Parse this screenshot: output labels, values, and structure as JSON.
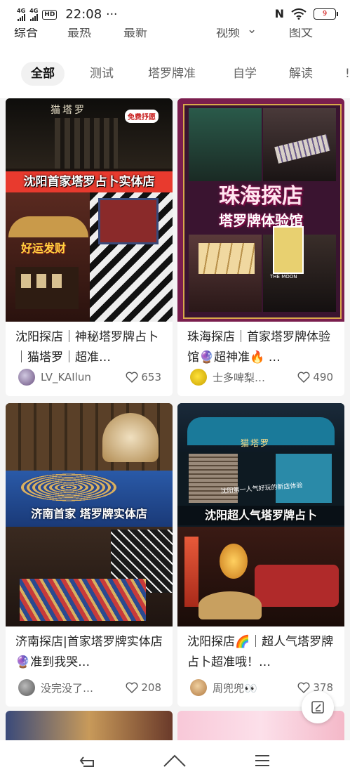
{
  "status_bar": {
    "network1": "4G",
    "network2": "4G",
    "hd": "HD",
    "time": "22:08",
    "more": "···",
    "nfc": "N",
    "battery": "9"
  },
  "top_tabs": [
    "综合",
    "最热",
    "最新",
    "视频",
    "图文"
  ],
  "filters": [
    "全部",
    "测试",
    "塔罗牌准",
    "自学",
    "解读"
  ],
  "cards": [
    {
      "title": "沈阳探店｜神秘塔罗牌占卜｜猫塔罗｜超准…",
      "author": "LV_KAIlun",
      "likes": "653",
      "banner": "沈阳首家塔罗占卜实体店",
      "sign": "猫塔罗",
      "sticker": "免费抒愿",
      "badge": "好运发财"
    },
    {
      "title": "珠海探店｜首家塔罗牌体验馆🔮超神准🔥 …",
      "author": "士多啤梨…",
      "likes": "490",
      "banner1": "珠海探店",
      "banner2": "塔罗牌体验馆",
      "card_label": "THE MOON"
    },
    {
      "title": "济南探店|首家塔罗牌实体店🔮准到我哭…",
      "author": "没完没了…",
      "likes": "208",
      "banner": "济南首家 塔罗牌实体店"
    },
    {
      "title": "沈阳探店🌈｜超人气塔罗牌占卜超准哦！…",
      "author": "周兜兜👀",
      "likes": "378",
      "banner": "沈阳超人气塔罗牌占卜",
      "sign": "猫塔罗",
      "caption": "沈阳第一人气好玩的新店体验"
    }
  ],
  "colors": {
    "accent": "#ff2442",
    "banner_red": "#e83a2e",
    "purple_frame": "#7a1e4e"
  }
}
